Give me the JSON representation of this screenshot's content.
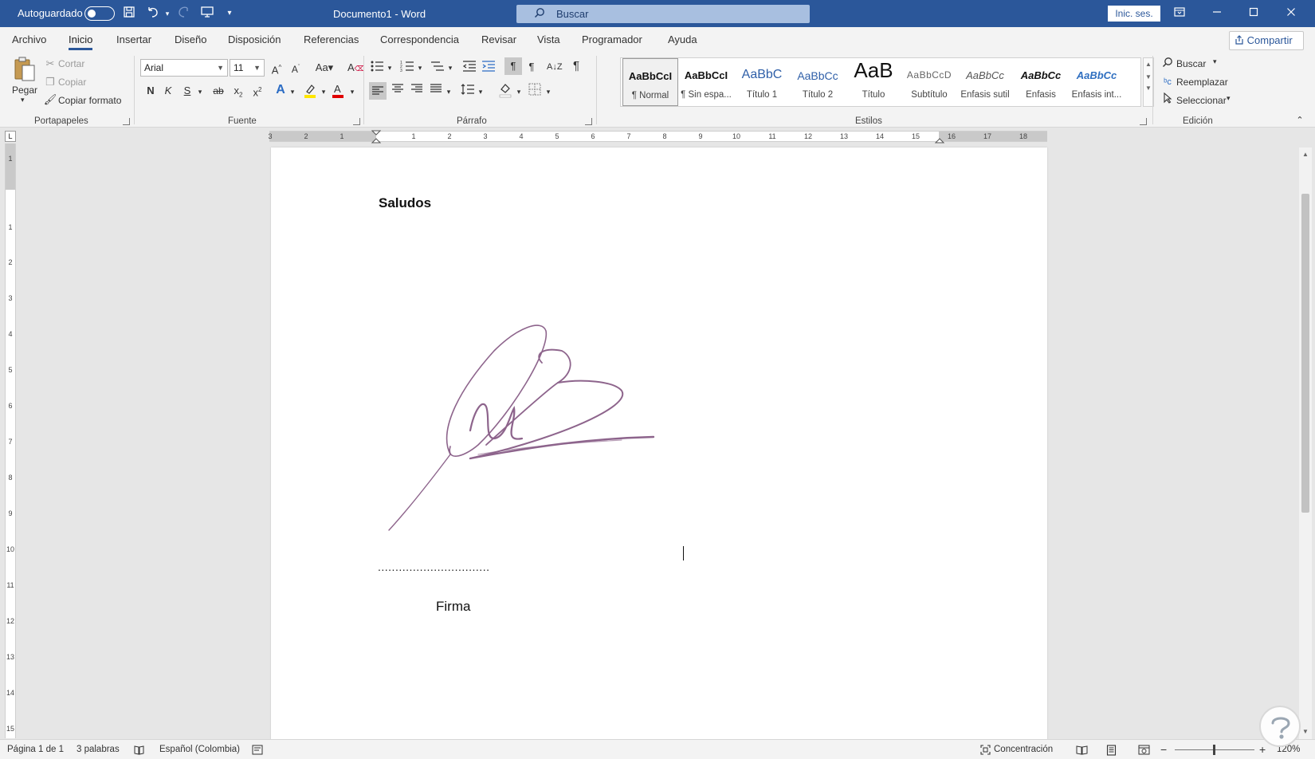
{
  "titlebar": {
    "autosave_label": "Autoguardado",
    "doc_title": "Documento1 - Word",
    "search_placeholder": "Buscar",
    "signin_label": "Inic. ses."
  },
  "menu": {
    "tabs": [
      {
        "label": "Archivo"
      },
      {
        "label": "Inicio",
        "active": true
      },
      {
        "label": "Insertar"
      },
      {
        "label": "Diseño"
      },
      {
        "label": "Disposición"
      },
      {
        "label": "Referencias"
      },
      {
        "label": "Correspondencia"
      },
      {
        "label": "Revisar"
      },
      {
        "label": "Vista"
      },
      {
        "label": "Programador"
      },
      {
        "label": "Ayuda"
      }
    ],
    "share_label": "Compartir"
  },
  "ribbon": {
    "clipboard": {
      "paste_label": "Pegar",
      "cut_label": "Cortar",
      "copy_label": "Copiar",
      "format_painter_label": "Copiar formato",
      "group_label": "Portapapeles"
    },
    "font": {
      "font_name": "Arial",
      "font_size": "11",
      "bold_label": "N",
      "italic_label": "K",
      "underline_label": "S",
      "strike_label": "ab",
      "group_label": "Fuente"
    },
    "paragraph": {
      "group_label": "Párrafo"
    },
    "styles": {
      "group_label": "Estilos",
      "items": [
        {
          "sample": "AaBbCcI",
          "name": "¶ Normal"
        },
        {
          "sample": "AaBbCcI",
          "name": "¶ Sin espa..."
        },
        {
          "sample": "AaBbC",
          "name": "Título 1"
        },
        {
          "sample": "AaBbCc",
          "name": "Título 2"
        },
        {
          "sample": "AaB",
          "name": "Título"
        },
        {
          "sample": "AaBbCcD",
          "name": "Subtítulo"
        },
        {
          "sample": "AaBbCc",
          "name": "Énfasis sutil"
        },
        {
          "sample": "AaBbCc",
          "name": "Énfasis"
        },
        {
          "sample": "AaBbCc",
          "name": "Énfasis int..."
        }
      ]
    },
    "editing": {
      "find_label": "Buscar",
      "replace_label": "Reemplazar",
      "select_label": "Seleccionar",
      "group_label": "Edición"
    }
  },
  "ruler": {
    "h_numbers": [
      "3",
      "2",
      "1",
      "1",
      "2",
      "3",
      "4",
      "5",
      "6",
      "7",
      "8",
      "9",
      "10",
      "11",
      "12",
      "13",
      "14",
      "15",
      "16",
      "17",
      "18"
    ],
    "v_numbers": [
      "1",
      "1",
      "2",
      "3",
      "4",
      "5",
      "6",
      "7",
      "8",
      "9",
      "10",
      "11",
      "12",
      "13",
      "14",
      "15"
    ],
    "corner": "L"
  },
  "document": {
    "greeting": "Saludos",
    "dotted_line": "................................",
    "signature_label": "Firma"
  },
  "statusbar": {
    "page": "Página 1 de 1",
    "words": "3 palabras",
    "language": "Español (Colombia)",
    "focus": "Concentración",
    "zoom": "120%"
  },
  "colors": {
    "title_bar": "#2b579a",
    "signature_ink": "#7a4a78",
    "highlight": "#ffe600",
    "font_color": "#e00000"
  }
}
